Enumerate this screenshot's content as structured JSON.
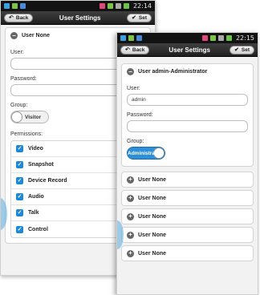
{
  "back_screen": {
    "statusbar": {
      "time": "22:14"
    },
    "header": {
      "back_label": "Back",
      "title": "User Settings",
      "set_label": "Set"
    },
    "section": {
      "title": "User None"
    },
    "user_field": {
      "label": "User:",
      "value": ""
    },
    "password_field": {
      "label": "Password:",
      "value": ""
    },
    "group": {
      "label": "Group:",
      "toggle_label": "Visitor"
    },
    "permissions": {
      "label": "Permissions:",
      "items": [
        {
          "label": "Video",
          "checked": true
        },
        {
          "label": "Snapshot",
          "checked": true
        },
        {
          "label": "Device Record",
          "checked": true
        },
        {
          "label": "Audio",
          "checked": true
        },
        {
          "label": "Talk",
          "checked": true
        },
        {
          "label": "Control",
          "checked": true
        }
      ]
    }
  },
  "front_screen": {
    "statusbar": {
      "time": "22:15"
    },
    "header": {
      "back_label": "Back",
      "title": "User Settings",
      "set_label": "Set"
    },
    "section": {
      "title": "User admin-Administrator"
    },
    "user_field": {
      "label": "User:",
      "value": "admin"
    },
    "password_field": {
      "label": "Password:",
      "value": ""
    },
    "group": {
      "label": "Group:",
      "toggle_label": "Administra"
    },
    "users": [
      {
        "label": "User None"
      },
      {
        "label": "User None"
      },
      {
        "label": "User None"
      },
      {
        "label": "User None"
      },
      {
        "label": "User None"
      }
    ]
  },
  "colors": {
    "accent": "#1e88d8",
    "toggle_on": "#2d8fd8",
    "titlebar": "#2a2a2a"
  }
}
